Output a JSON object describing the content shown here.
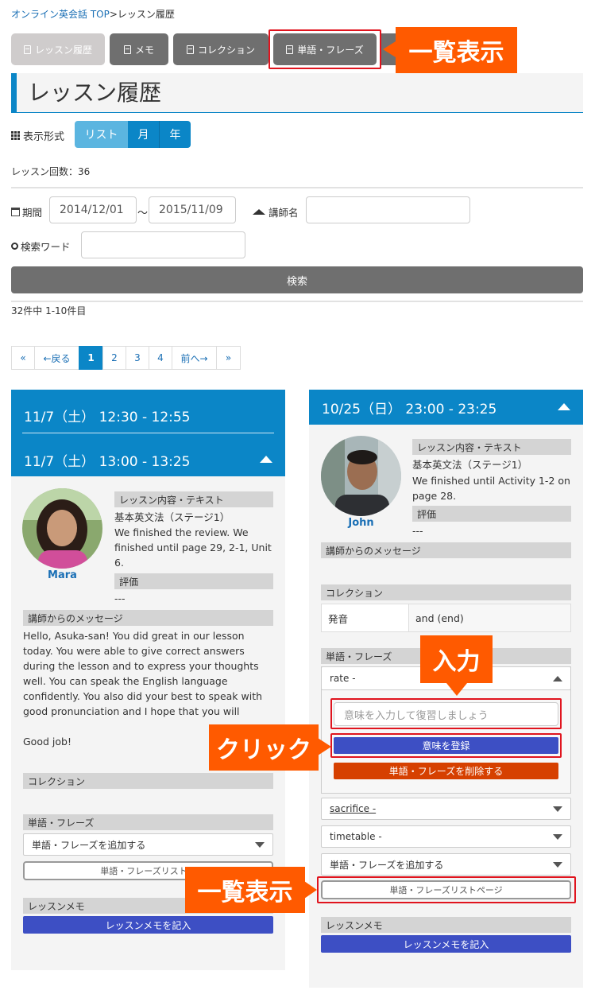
{
  "breadcrumb": {
    "home": "オンライン英会話 TOP",
    "sep": ">",
    "current": "レッスン履歴"
  },
  "tabs": {
    "history": "レッスン履歴",
    "memo": "メモ",
    "collection": "コレクション",
    "words": "単語・フレーズ"
  },
  "callouts": {
    "list_top": "一覧表示",
    "input": "入力",
    "click": "クリック",
    "list_bottom": "一覧表示"
  },
  "page_title": "レッスン履歴",
  "view": {
    "label": "表示形式",
    "options": [
      "リスト",
      "月",
      "年"
    ],
    "active": "リスト"
  },
  "lesson_count": "レッスン回数：36",
  "filter": {
    "period_label": "期間",
    "from": "2014/12/01",
    "tilde": "～",
    "to": "2015/11/09",
    "teacher_label": "講師名",
    "teacher_value": "",
    "keyword_label": "検索ワード",
    "keyword_value": "",
    "search_button": "検索"
  },
  "result_summary": "32件中 1-10件目",
  "pagination": {
    "first": "«",
    "prev": "←戻る",
    "pages": [
      "1",
      "2",
      "3",
      "4"
    ],
    "current": "1",
    "next": "前へ→",
    "last": "»"
  },
  "colors": {
    "accent": "#0b86c7",
    "callout": "#ff5a00",
    "red": "#e0141e",
    "blue_button": "#3d4fc4",
    "delete_button": "#d64000"
  },
  "left": {
    "time1": "11/7（土） 12:30 - 12:55",
    "time2": "11/7（土） 13:00 - 13:25",
    "teacher": "Mara",
    "content_label": "レッスン内容・テキスト",
    "course": "基本英文法（ステージ1）",
    "content": "We finished the review. We finished until page 29, 2-1, Unit 6.",
    "rating_label": "評価",
    "rating": "---",
    "message_label": "講師からのメッセージ",
    "message": "Hello, Asuka-san! You did great in our lesson today. You were able to give correct answers during the lesson and to express your thoughts well. You can speak the English language confidently. You also did your best to speak with good pronunciation and I hope that you will continue to practice your i",
    "message_tail": "Good job!",
    "collection_label": "コレクション",
    "words_label": "単語・フレーズ",
    "add_word": "単語・フレーズを追加する",
    "word_list_button": "単語・フレーズリストペ",
    "memo_label": "レッスンメモ",
    "memo_button": "レッスンメモを記入"
  },
  "right": {
    "time": "10/25（日） 23:00 - 23:25",
    "teacher": "John",
    "content_label": "レッスン内容・テキスト",
    "course": "基本英文法（ステージ1）",
    "content": "We finished until Activity 1-2 on page 28.",
    "rating_label": "評価",
    "rating": "---",
    "message_label": "講師からのメッセージ",
    "collection_label": "コレクション",
    "collection_rows": [
      {
        "word": "発音",
        "meaning": "and (end)"
      }
    ],
    "words_label": "単語・フレーズ",
    "word_open": "rate -",
    "meaning_placeholder": "意味を入力して復習しましょう",
    "register_button": "意味を登録",
    "delete_button": "単語・フレーズを削除する",
    "word2": "sacrifice -",
    "word3": "timetable -",
    "add_word": "単語・フレーズを追加する",
    "word_list_button": "単語・フレーズリストページ",
    "memo_label": "レッスンメモ",
    "memo_button": "レッスンメモを記入"
  }
}
